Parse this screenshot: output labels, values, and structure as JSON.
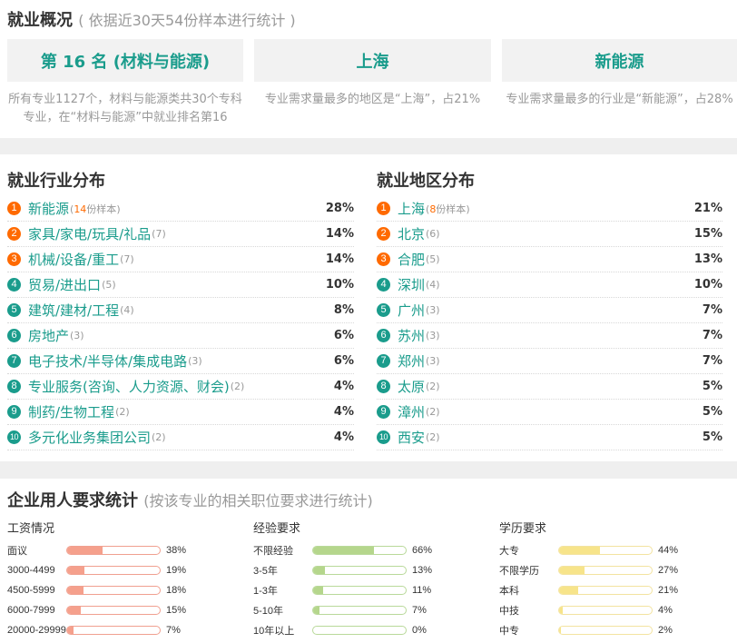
{
  "overview": {
    "title": "就业概况",
    "subtitle": "( 依据近30天54份样本进行统计 )",
    "cards": [
      {
        "headline": "第 16 名 (材料与能源)",
        "desc": "所有专业1127个，材料与能源类共30个专科专业，在“材料与能源”中就业排名第16"
      },
      {
        "headline": "上海",
        "desc": "专业需求量最多的地区是“上海”，占21%"
      },
      {
        "headline": "新能源",
        "desc": "专业需求量最多的行业是“新能源”，占28%"
      }
    ]
  },
  "industry": {
    "title": "就业行业分布",
    "sample_suffix": "份样本",
    "items": [
      {
        "rank": "1",
        "name": "新能源",
        "count": "14",
        "pct": "28%"
      },
      {
        "rank": "2",
        "name": "家具/家电/玩具/礼品",
        "count": "(7)",
        "pct": "14%"
      },
      {
        "rank": "3",
        "name": "机械/设备/重工",
        "count": "(7)",
        "pct": "14%"
      },
      {
        "rank": "4",
        "name": "贸易/进出口",
        "count": "(5)",
        "pct": "10%"
      },
      {
        "rank": "5",
        "name": "建筑/建材/工程",
        "count": "(4)",
        "pct": "8%"
      },
      {
        "rank": "6",
        "name": "房地产",
        "count": "(3)",
        "pct": "6%"
      },
      {
        "rank": "7",
        "name": "电子技术/半导体/集成电路",
        "count": "(3)",
        "pct": "6%"
      },
      {
        "rank": "8",
        "name": "专业服务(咨询、人力资源、财会)",
        "count": "(2)",
        "pct": "4%"
      },
      {
        "rank": "9",
        "name": "制药/生物工程",
        "count": "(2)",
        "pct": "4%"
      },
      {
        "rank": "10",
        "name": "多元化业务集团公司",
        "count": "(2)",
        "pct": "4%"
      }
    ]
  },
  "region": {
    "title": "就业地区分布",
    "sample_suffix": "份样本",
    "items": [
      {
        "rank": "1",
        "name": "上海",
        "count": "8",
        "pct": "21%"
      },
      {
        "rank": "2",
        "name": "北京",
        "count": "(6)",
        "pct": "15%"
      },
      {
        "rank": "3",
        "name": "合肥",
        "count": "(5)",
        "pct": "13%"
      },
      {
        "rank": "4",
        "name": "深圳",
        "count": "(4)",
        "pct": "10%"
      },
      {
        "rank": "5",
        "name": "广州",
        "count": "(3)",
        "pct": "7%"
      },
      {
        "rank": "6",
        "name": "苏州",
        "count": "(3)",
        "pct": "7%"
      },
      {
        "rank": "7",
        "name": "郑州",
        "count": "(3)",
        "pct": "7%"
      },
      {
        "rank": "8",
        "name": "太原",
        "count": "(2)",
        "pct": "5%"
      },
      {
        "rank": "9",
        "name": "漳州",
        "count": "(2)",
        "pct": "5%"
      },
      {
        "rank": "10",
        "name": "西安",
        "count": "(2)",
        "pct": "5%"
      }
    ]
  },
  "requirements": {
    "title": "企业用人要求统计",
    "subtitle": "(按该专业的相关职位要求进行统计)",
    "salary": {
      "title": "工资情况",
      "rows": [
        {
          "label": "面议",
          "pct": "38%",
          "value": 38
        },
        {
          "label": "3000-4499",
          "pct": "19%",
          "value": 19
        },
        {
          "label": "4500-5999",
          "pct": "18%",
          "value": 18
        },
        {
          "label": "6000-7999",
          "pct": "15%",
          "value": 15
        },
        {
          "label": "20000-29999",
          "pct": "7%",
          "value": 7
        }
      ]
    },
    "experience": {
      "title": "经验要求",
      "rows": [
        {
          "label": "不限经验",
          "pct": "66%",
          "value": 66
        },
        {
          "label": "3-5年",
          "pct": "13%",
          "value": 13
        },
        {
          "label": "1-3年",
          "pct": "11%",
          "value": 11
        },
        {
          "label": "5-10年",
          "pct": "7%",
          "value": 7
        },
        {
          "label": "10年以上",
          "pct": "0%",
          "value": 0
        }
      ]
    },
    "education": {
      "title": "学历要求",
      "rows": [
        {
          "label": "大专",
          "pct": "44%",
          "value": 44
        },
        {
          "label": "不限学历",
          "pct": "27%",
          "value": 27
        },
        {
          "label": "本科",
          "pct": "21%",
          "value": 21
        },
        {
          "label": "中技",
          "pct": "4%",
          "value": 4
        },
        {
          "label": "中专",
          "pct": "2%",
          "value": 2
        }
      ]
    }
  },
  "colors": {
    "accent": "#1a9c8c",
    "rank_top": "#ff6a00",
    "salary_bar": "#f5a08c",
    "experience_bar": "#b5d68c",
    "education_bar": "#f7e48a"
  }
}
